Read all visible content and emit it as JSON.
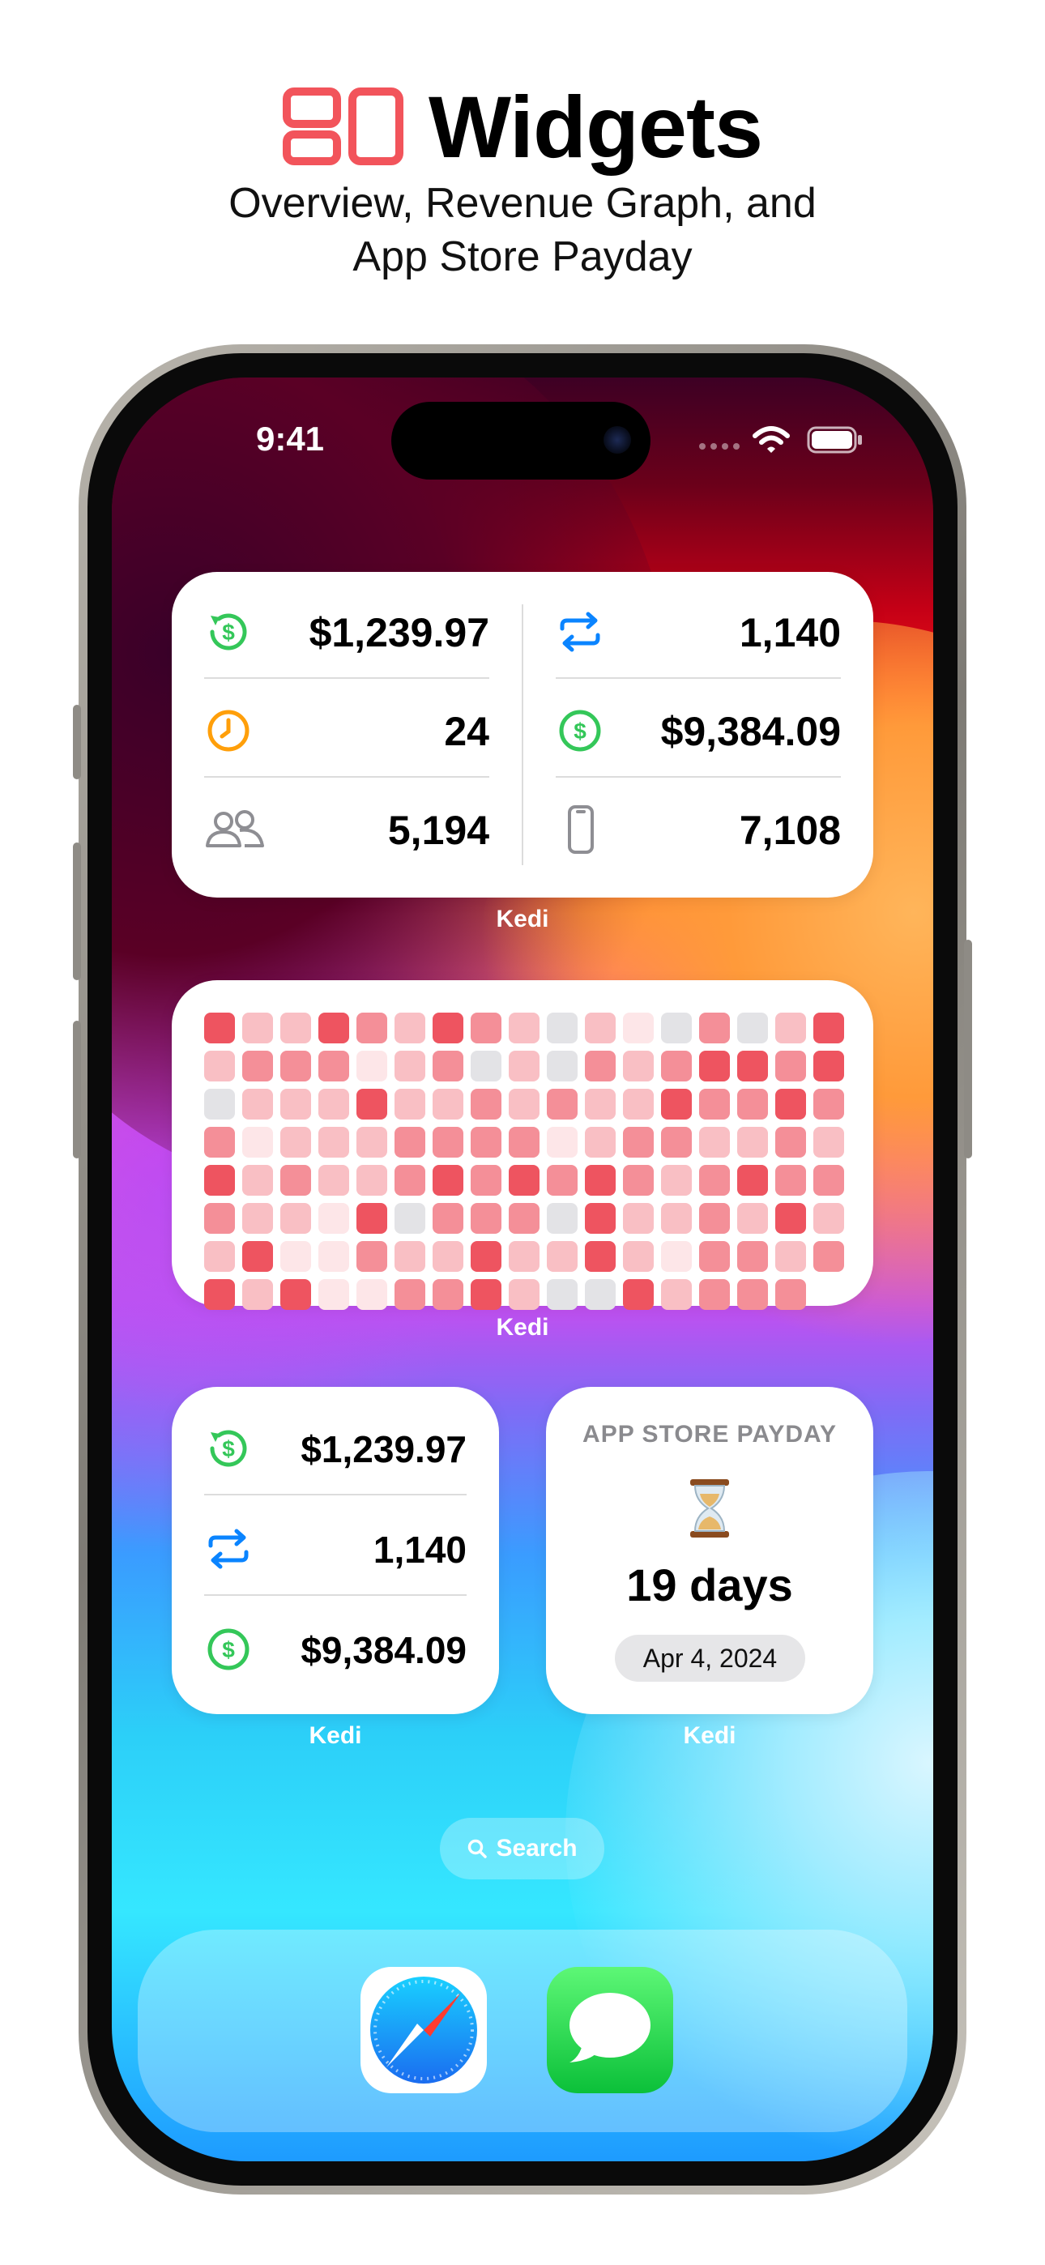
{
  "header": {
    "title": "Widgets",
    "subtitle_line1": "Overview, Revenue Graph, and",
    "subtitle_line2": "App Store Payday",
    "accent_color": "#f2545b"
  },
  "status_bar": {
    "time": "9:41"
  },
  "overview_widget": {
    "left": [
      {
        "icon": "revenue-refresh-icon",
        "value": "$1,239.97"
      },
      {
        "icon": "clock-icon",
        "value": "24"
      },
      {
        "icon": "users-icon",
        "value": "5,194"
      }
    ],
    "right": [
      {
        "icon": "renewal-arrows-icon",
        "value": "1,140"
      },
      {
        "icon": "dollar-icon",
        "value": "$9,384.09"
      },
      {
        "icon": "phone-icon",
        "value": "7,108"
      }
    ],
    "caption": "Kedi"
  },
  "revenue_graph_widget": {
    "caption": "Kedi",
    "palette": [
      "#e3e3e6",
      "#fde6e8",
      "#f9bfc4",
      "#f48f98",
      "#ee5460"
    ],
    "levels": [
      [
        4,
        2,
        2,
        4,
        3,
        2,
        4,
        3,
        2,
        0,
        2,
        1,
        0,
        3,
        0,
        2,
        4
      ],
      [
        2,
        3,
        3,
        3,
        1,
        2,
        3,
        0,
        2,
        0,
        3,
        2,
        3,
        4,
        4,
        3,
        4
      ],
      [
        0,
        2,
        2,
        2,
        4,
        2,
        2,
        3,
        2,
        3,
        2,
        2,
        4,
        3,
        3,
        4,
        3
      ],
      [
        3,
        1,
        2,
        2,
        2,
        3,
        3,
        3,
        3,
        1,
        2,
        3,
        3,
        2,
        2,
        3,
        2
      ],
      [
        4,
        2,
        3,
        2,
        2,
        3,
        4,
        3,
        4,
        3,
        4,
        3,
        2,
        3,
        4,
        3,
        3
      ],
      [
        3,
        2,
        2,
        1,
        4,
        0,
        3,
        3,
        3,
        0,
        4,
        2,
        2,
        3,
        2,
        4,
        2
      ],
      [
        2,
        4,
        1,
        1,
        3,
        2,
        2,
        4,
        2,
        2,
        4,
        2,
        1,
        3,
        3,
        2,
        3
      ],
      [
        4,
        2,
        4,
        1,
        1,
        3,
        3,
        4,
        2,
        0,
        0,
        4,
        2,
        3,
        3,
        3,
        null
      ]
    ]
  },
  "small_overview_widget": {
    "rows": [
      {
        "icon": "revenue-refresh-icon",
        "value": "$1,239.97"
      },
      {
        "icon": "renewal-arrows-icon",
        "value": "1,140"
      },
      {
        "icon": "dollar-icon",
        "value": "$9,384.09"
      }
    ],
    "caption": "Kedi"
  },
  "payday_widget": {
    "title": "APP STORE PAYDAY",
    "emoji": "⏳",
    "days": "19 days",
    "date": "Apr 4, 2024",
    "caption": "Kedi"
  },
  "search": {
    "label": "Search"
  },
  "dock": {
    "apps": [
      "Safari",
      "Messages"
    ]
  }
}
